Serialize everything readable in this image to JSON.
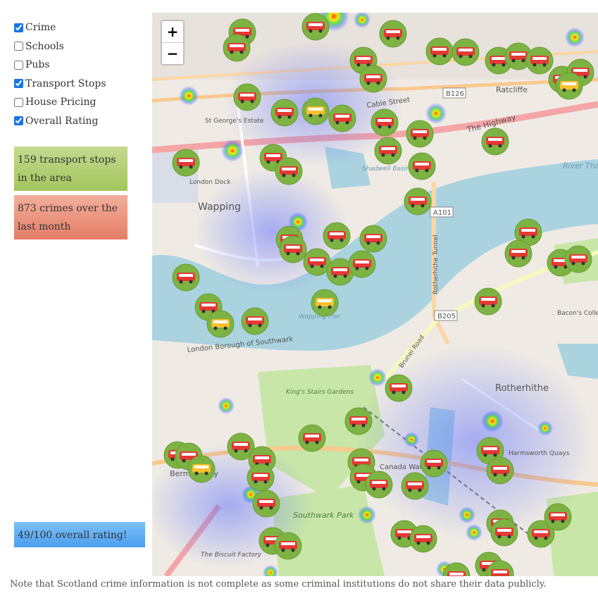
{
  "layers": [
    {
      "label": "Crime",
      "checked": true
    },
    {
      "label": "Schools",
      "checked": false
    },
    {
      "label": "Pubs",
      "checked": false
    },
    {
      "label": "Transport Stops",
      "checked": true
    },
    {
      "label": "House Pricing",
      "checked": false
    },
    {
      "label": "Overall Rating",
      "checked": true
    }
  ],
  "info": {
    "transport": "159 transport stops in the area",
    "crime": "873 crimes over the last month",
    "rating": "49/100 overall rating!"
  },
  "map": {
    "zoom_in": "+",
    "zoom_out": "−",
    "labels": {
      "wapping": "Wapping",
      "rotherhithe": "Rotherhithe",
      "the_highway": "The Highway",
      "river_thames": "River Thames",
      "cable_street": "Cable Street",
      "ratcliffe": "Ratcliffe",
      "shadwell_basin": "Shadwell Basin",
      "kings_stairs": "King's Stairs Gardens",
      "southwark_park": "Southwark Park",
      "harmsworth": "Harmsworth Quays",
      "canada_water": "Canada Water",
      "bermondsey": "Bermondsey",
      "lb_southwark": "London Borough of Southwark",
      "rotherhithe_tunnel": "Rotherhithe Tunnel",
      "brunel_road": "Brunel Road",
      "a101": "A101",
      "b205": "B205",
      "b126": "B126",
      "bacons_college": "Bacon's College",
      "wapping_pier": "Wapping Pier",
      "london_dock": "London Dock",
      "biscuit_factory": "The Biscuit Factory",
      "st_georges": "St George's Estate"
    }
  },
  "footnote": "Note that Scotland crime information is not complete as some criminal institutions do not share their data publicly.",
  "colors": {
    "water": "#aad3df",
    "park": "#c8e6a8",
    "marker": "#7cb342",
    "bus": "#e53935",
    "train": "#fbc02d",
    "transport_box": "#a3c65d",
    "crime_box": "#e47d66",
    "rating_box": "#4a9ff0"
  }
}
